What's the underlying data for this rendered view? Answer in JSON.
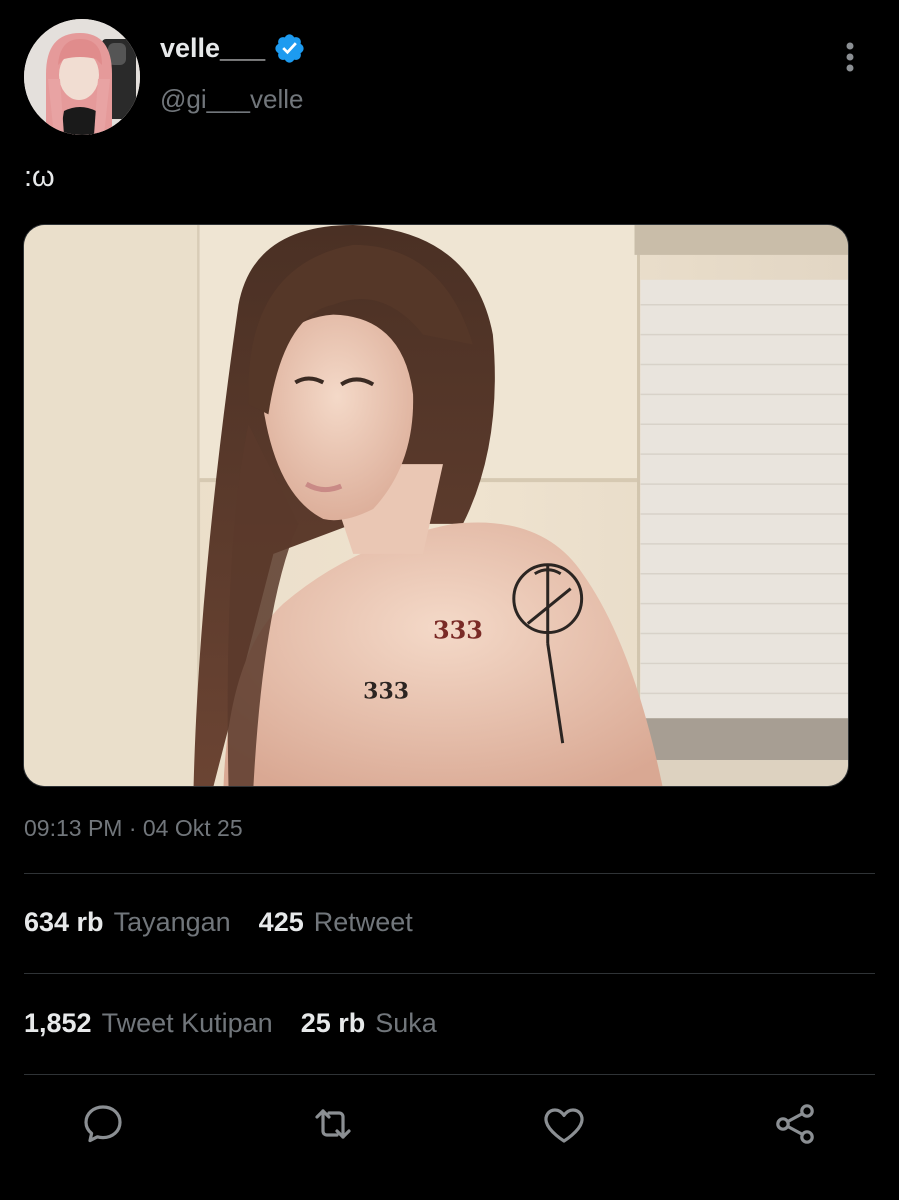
{
  "user": {
    "display_name": "velle___",
    "handle": "@gi___velle",
    "verified": true
  },
  "tweet": {
    "text": ":ω",
    "timestamp": "09:13 PM · 04 Okt 25"
  },
  "stats": {
    "views_count": "634 rb",
    "views_label": "Tayangan",
    "retweets_count": "425",
    "retweets_label": "Retweet",
    "quotes_count": "1,852",
    "quotes_label": "Tweet Kutipan",
    "likes_count": "25 rb",
    "likes_label": "Suka"
  },
  "actions": [
    "reply-icon",
    "retweet-icon",
    "like-icon",
    "share-icon"
  ],
  "colors": {
    "background": "#000000",
    "text_primary": "#e7e9ea",
    "text_secondary": "#71767b",
    "divider": "#2f3336",
    "verified": "#1d9bf0"
  }
}
